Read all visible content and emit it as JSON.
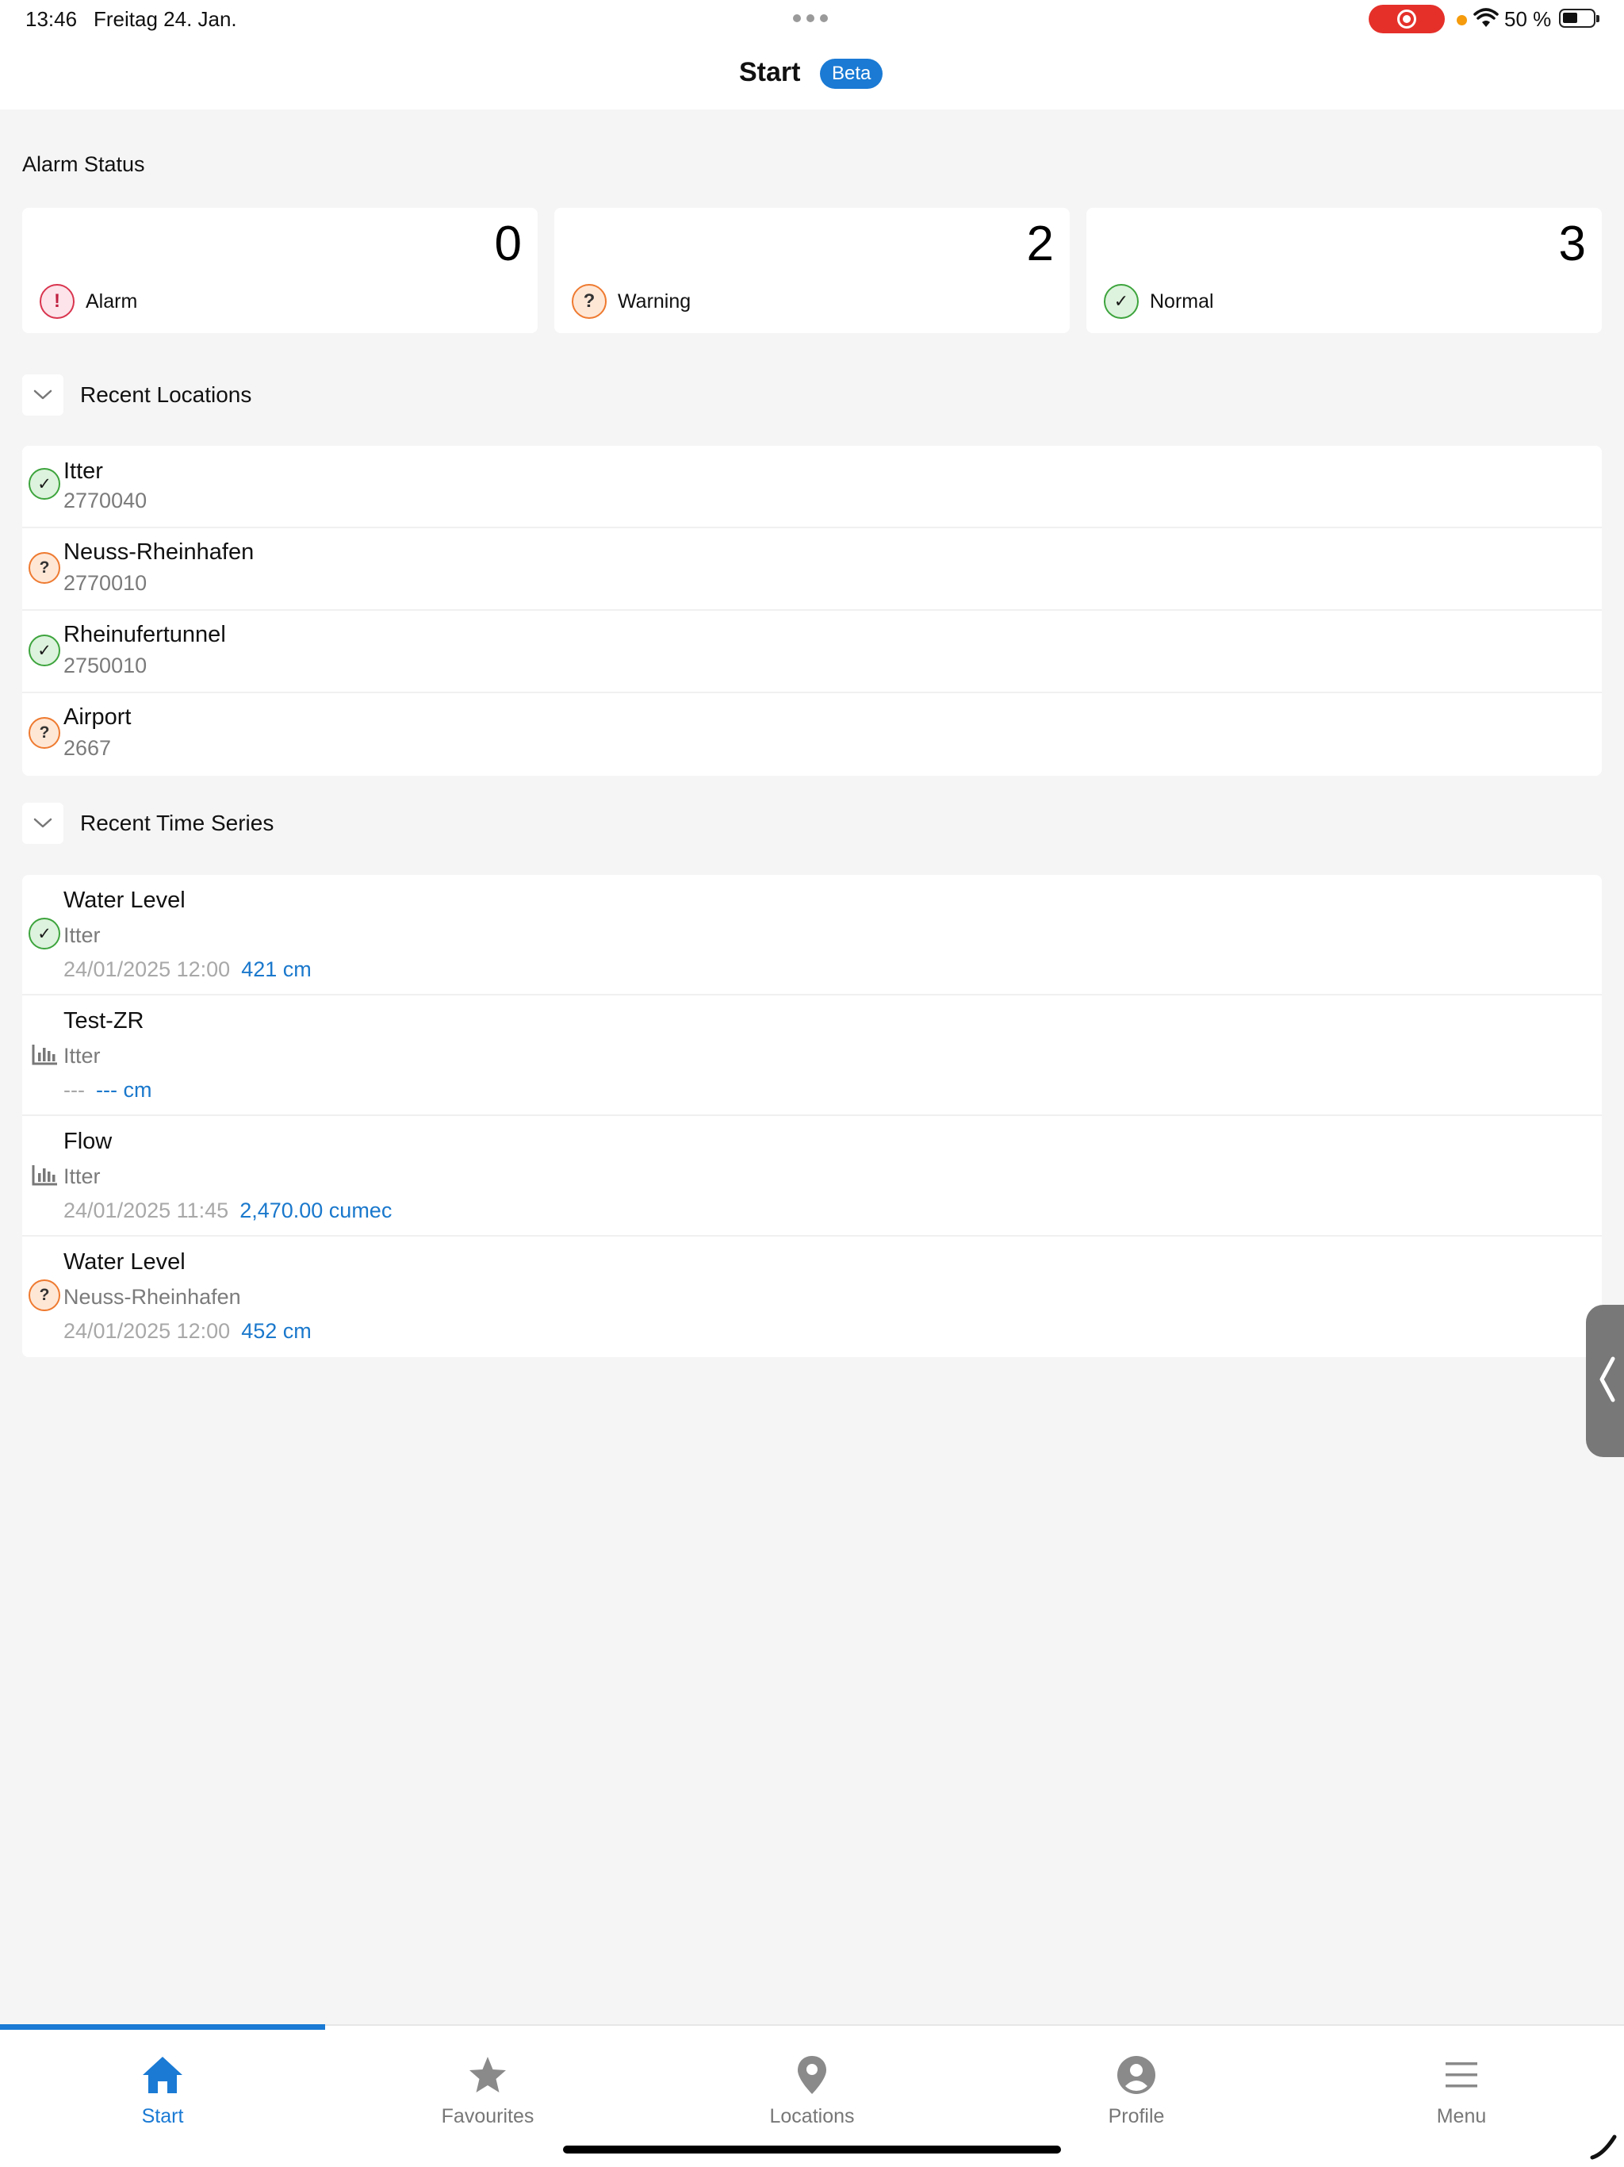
{
  "status_bar": {
    "time": "13:46",
    "date": "Freitag 24. Jan.",
    "battery": "50 %"
  },
  "header": {
    "title": "Start",
    "badge": "Beta"
  },
  "alarm_status": {
    "title": "Alarm Status",
    "cards": [
      {
        "count": "0",
        "label": "Alarm",
        "status": "alarm"
      },
      {
        "count": "2",
        "label": "Warning",
        "status": "warning"
      },
      {
        "count": "3",
        "label": "Normal",
        "status": "normal"
      }
    ]
  },
  "recent_locations": {
    "title": "Recent Locations",
    "items": [
      {
        "name": "Itter",
        "id": "2770040",
        "status": "normal"
      },
      {
        "name": "Neuss-Rheinhafen",
        "id": "2770010",
        "status": "warning"
      },
      {
        "name": "Rheinufertunnel",
        "id": "2750010",
        "status": "normal"
      },
      {
        "name": "Airport",
        "id": "2667",
        "status": "warning"
      }
    ]
  },
  "recent_time_series": {
    "title": "Recent Time Series",
    "items": [
      {
        "name": "Water Level",
        "location": "Itter",
        "timestamp": "24/01/2025 12:00",
        "value": "421 cm",
        "icon": "normal"
      },
      {
        "name": "Test-ZR",
        "location": "Itter",
        "timestamp": "---",
        "value": "--- cm",
        "icon": "chart-icon"
      },
      {
        "name": "Flow",
        "location": "Itter",
        "timestamp": "24/01/2025 11:45",
        "value": "2,470.00 cumec",
        "icon": "chart-icon"
      },
      {
        "name": "Water Level",
        "location": "Neuss-Rheinhafen",
        "timestamp": "24/01/2025 12:00",
        "value": "452 cm",
        "icon": "warning"
      }
    ]
  },
  "tabbar": {
    "items": [
      {
        "label": "Start",
        "icon": "home-icon",
        "active": true
      },
      {
        "label": "Favourites",
        "icon": "star-icon",
        "active": false
      },
      {
        "label": "Locations",
        "icon": "location-pin-icon",
        "active": false
      },
      {
        "label": "Profile",
        "icon": "profile-icon",
        "active": false
      },
      {
        "label": "Menu",
        "icon": "menu-icon",
        "active": false
      }
    ]
  },
  "colors": {
    "accent": "#1a7ad4",
    "alarm": "#d9344e",
    "warning": "#ee7a30",
    "normal": "#3da43d",
    "value_text": "#1a78cc"
  }
}
